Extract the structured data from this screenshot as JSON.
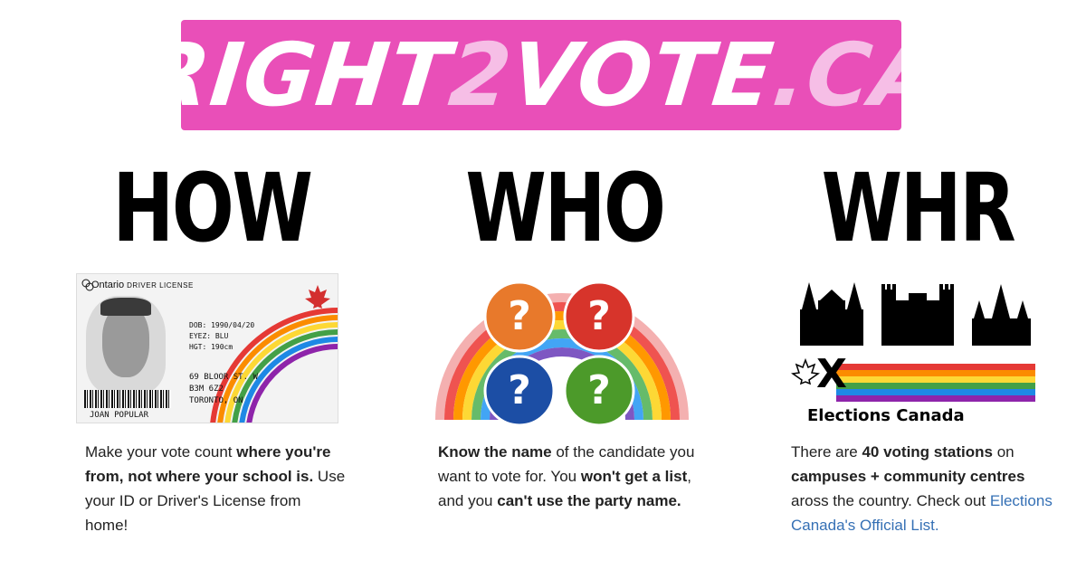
{
  "logo": {
    "part1": "RIGHT",
    "part2": "2",
    "part3": "VOTE",
    "part4": ".CA"
  },
  "columns": [
    {
      "heading": "HOW",
      "desc_1": "Make your vote count ",
      "desc_2": "where you're from, not where your school is.",
      "desc_3": " Use your ID or Driver's License from home!"
    },
    {
      "heading": "WHO",
      "desc_1": "Know the name",
      "desc_2": " of the candidate you want to vote for. You ",
      "desc_3": "won't get a list",
      "desc_4": ", and you ",
      "desc_5": "can't use the party name."
    },
    {
      "heading": "WHR",
      "desc_1": "There are ",
      "desc_2": "40 voting stations",
      "desc_3": " on ",
      "desc_4": "campuses + community centres",
      "desc_5": " aross the country. Check out ",
      "link": "Elections Canada's Official List."
    }
  ],
  "id_card": {
    "province": "Ontario",
    "type": "DRIVER LICENSE",
    "dob": "DOB: 1990/04/20",
    "eyes": "EYEZ: BLU",
    "height": "HGT: 190cm",
    "addr1": "69 BLOOR ST. W",
    "addr2": "B3M 6Z2",
    "addr3": "TORONTO, ON",
    "name": "JOAN POPULAR"
  },
  "question_bubbles": [
    "?",
    "?",
    "?",
    "?"
  ],
  "elections_logo": {
    "mark": "X",
    "text": "Elections Canada"
  },
  "colors": {
    "logo_bg": "#e94fb8",
    "logo_accent": "#f6bee6",
    "link": "#3570b5",
    "bubble_orange": "#e8792b",
    "bubble_red": "#d7342b",
    "bubble_blue": "#1c4ea5",
    "bubble_green": "#4c9a2a"
  }
}
